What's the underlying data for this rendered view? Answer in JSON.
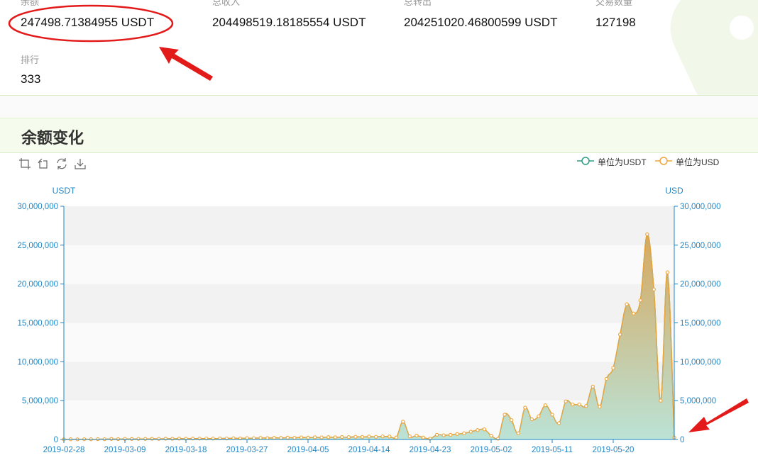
{
  "stats": [
    {
      "label": "余额",
      "value": "247498.71384955 USDT"
    },
    {
      "label": "总收入",
      "value": "204498519.18185554 USDT"
    },
    {
      "label": "总转出",
      "value": "204251020.46800599 USDT"
    },
    {
      "label": "交易数量",
      "value": "127198"
    },
    {
      "label": "排行",
      "value": "333"
    }
  ],
  "section": {
    "title": "余额变化"
  },
  "toolbox": {
    "icons": [
      "area-zoom-icon",
      "zoom-reset-icon",
      "restore-icon",
      "save-image-icon"
    ]
  },
  "colors": {
    "usdt_series": "#2f9c84",
    "usd_series": "#f0a53a",
    "axis": "#1f86c5",
    "annotation": "#e31a1a",
    "header_bg": "#f6fced"
  },
  "chart_data": {
    "type": "area",
    "x": [
      "2019-02-28",
      "2019-03-01",
      "2019-03-02",
      "2019-03-03",
      "2019-03-04",
      "2019-03-05",
      "2019-03-06",
      "2019-03-07",
      "2019-03-08",
      "2019-03-09",
      "2019-03-10",
      "2019-03-11",
      "2019-03-12",
      "2019-03-13",
      "2019-03-14",
      "2019-03-15",
      "2019-03-16",
      "2019-03-17",
      "2019-03-18",
      "2019-03-19",
      "2019-03-20",
      "2019-03-21",
      "2019-03-22",
      "2019-03-23",
      "2019-03-24",
      "2019-03-25",
      "2019-03-26",
      "2019-03-27",
      "2019-03-28",
      "2019-03-29",
      "2019-03-30",
      "2019-03-31",
      "2019-04-01",
      "2019-04-02",
      "2019-04-03",
      "2019-04-04",
      "2019-04-05",
      "2019-04-06",
      "2019-04-07",
      "2019-04-08",
      "2019-04-09",
      "2019-04-10",
      "2019-04-11",
      "2019-04-12",
      "2019-04-13",
      "2019-04-14",
      "2019-04-15",
      "2019-04-16",
      "2019-04-17",
      "2019-04-18",
      "2019-04-19",
      "2019-04-20",
      "2019-04-21",
      "2019-04-22",
      "2019-04-23",
      "2019-04-24",
      "2019-04-25",
      "2019-04-26",
      "2019-04-27",
      "2019-04-28",
      "2019-04-29",
      "2019-04-30",
      "2019-05-01",
      "2019-05-02",
      "2019-05-03",
      "2019-05-04",
      "2019-05-05",
      "2019-05-06",
      "2019-05-07",
      "2019-05-08",
      "2019-05-09",
      "2019-05-10",
      "2019-05-11",
      "2019-05-12",
      "2019-05-13",
      "2019-05-14",
      "2019-05-15",
      "2019-05-16",
      "2019-05-17",
      "2019-05-18",
      "2019-05-19",
      "2019-05-20",
      "2019-05-21",
      "2019-05-22",
      "2019-05-23",
      "2019-05-24",
      "2019-05-25",
      "2019-05-26",
      "2019-05-27",
      "2019-05-28",
      "2019-05-29"
    ],
    "x_ticks": [
      "2019-02-28",
      "2019-03-09",
      "2019-03-18",
      "2019-03-27",
      "2019-04-05",
      "2019-04-14",
      "2019-04-23",
      "2019-05-02",
      "2019-05-11",
      "2019-05-20"
    ],
    "series": [
      {
        "name": "单位为USDT",
        "values": [
          20000,
          30000,
          20000,
          40000,
          30000,
          50000,
          40000,
          60000,
          50000,
          70000,
          60000,
          80000,
          70000,
          90000,
          80000,
          100000,
          90000,
          110000,
          100000,
          120000,
          110000,
          130000,
          120000,
          140000,
          130000,
          160000,
          140000,
          180000,
          160000,
          200000,
          180000,
          220000,
          200000,
          240000,
          220000,
          260000,
          240000,
          280000,
          260000,
          300000,
          280000,
          320000,
          300000,
          350000,
          330000,
          380000,
          350000,
          400000,
          380000,
          250000,
          2300000,
          400000,
          500000,
          250000,
          100000,
          600000,
          550000,
          600000,
          700000,
          800000,
          1000000,
          1200000,
          1300000,
          500000,
          100000,
          3200000,
          2500000,
          800000,
          4100000,
          2600000,
          3000000,
          4400000,
          3200000,
          2100000,
          4900000,
          4500000,
          4500000,
          4300000,
          6800000,
          4200000,
          7800000,
          9200000,
          13500000,
          17400000,
          16200000,
          17900000,
          26400000,
          19300000,
          5000000,
          21500000,
          250000
        ]
      },
      {
        "name": "单位为USD",
        "values": [
          20000,
          30000,
          20000,
          40000,
          30000,
          50000,
          40000,
          60000,
          50000,
          70000,
          60000,
          80000,
          70000,
          90000,
          80000,
          100000,
          90000,
          110000,
          100000,
          120000,
          110000,
          130000,
          120000,
          140000,
          130000,
          160000,
          140000,
          180000,
          160000,
          200000,
          180000,
          220000,
          200000,
          240000,
          220000,
          260000,
          240000,
          280000,
          260000,
          300000,
          280000,
          320000,
          300000,
          350000,
          330000,
          380000,
          350000,
          400000,
          380000,
          250000,
          2300000,
          400000,
          500000,
          250000,
          100000,
          600000,
          550000,
          600000,
          700000,
          800000,
          1000000,
          1200000,
          1300000,
          500000,
          100000,
          3200000,
          2500000,
          800000,
          4100000,
          2600000,
          3000000,
          4400000,
          3200000,
          2100000,
          4900000,
          4500000,
          4500000,
          4300000,
          6800000,
          4200000,
          7800000,
          9200000,
          13500000,
          17400000,
          16200000,
          17900000,
          26400000,
          19300000,
          5000000,
          21500000,
          250000
        ]
      }
    ],
    "y_left": {
      "label": "USDT",
      "ticks": [
        "0",
        "5,000,000",
        "10,000,000",
        "15,000,000",
        "20,000,000",
        "25,000,000",
        "30,000,000"
      ],
      "ylim": [
        0,
        30000000
      ]
    },
    "y_right": {
      "label": "USD",
      "ticks": [
        "0",
        "5,000,000",
        "10,000,000",
        "15,000,000",
        "20,000,000",
        "25,000,000",
        "30,000,000"
      ],
      "ylim": [
        0,
        30000000
      ]
    },
    "grid": "alternating bands",
    "legend_position": "top-right"
  }
}
